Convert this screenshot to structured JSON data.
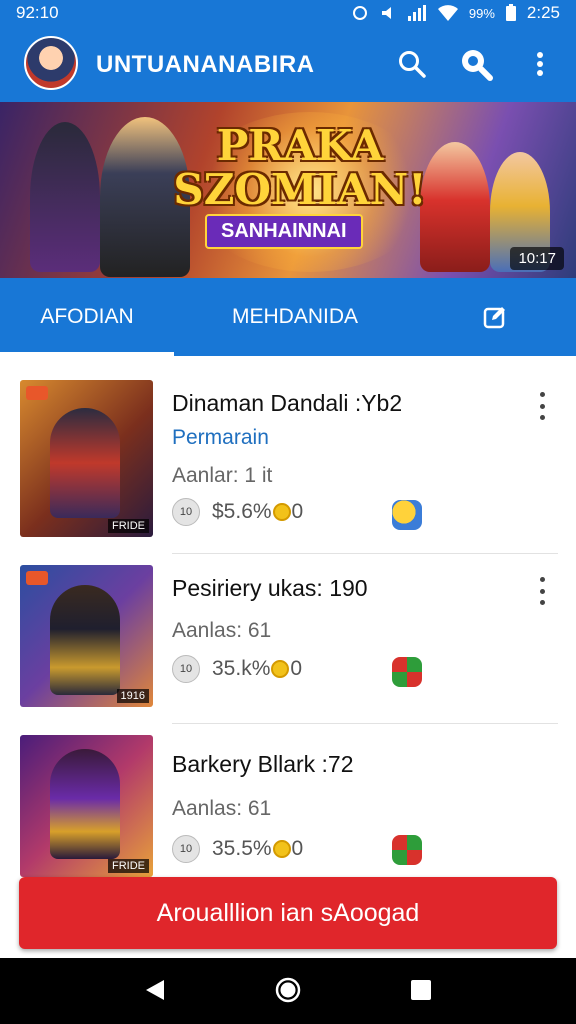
{
  "status_bar": {
    "time_left": "92:10",
    "battery": "99%",
    "time_right": "2:25"
  },
  "app_bar": {
    "title": "UNTUANANABIRA",
    "icons": [
      "avatar",
      "search-icon",
      "search-filled-icon",
      "more-vert-icon"
    ]
  },
  "banner": {
    "title": "PRAKA SZOMIAN!",
    "subtitle": "SANHAINNAI",
    "timestamp": "10:17"
  },
  "tabs": [
    {
      "label": "AFODIAN",
      "selected": true
    },
    {
      "label": "MEHDANIDA",
      "selected": false
    },
    {
      "label": "",
      "icon": "edit-icon"
    }
  ],
  "items": [
    {
      "title": "Dinaman Dandali :Yb2",
      "subtitle": "Permarain",
      "meta": "Aanlar: 1 it",
      "chip": "10",
      "price": "$5.6%",
      "coin_suffix": "0",
      "thumb_tag": "FRIDE",
      "icon": "emoji-icon"
    },
    {
      "title": "Pesiriery ukas: 190",
      "subtitle": "",
      "meta": "Aanlas: 61",
      "chip": "10",
      "price": "35.k%",
      "coin_suffix": "0",
      "thumb_tag": "1916",
      "icon": "green-red-icon"
    },
    {
      "title": "Barkery Bllark :72",
      "subtitle": "",
      "meta": "Aanlas: 61",
      "chip": "10",
      "price": "35.5%",
      "coin_suffix": "0",
      "thumb_tag": "FRIDE",
      "icon": "green-red-icon"
    }
  ],
  "cta": {
    "label": "Aroualllion ian sAoogad"
  },
  "colors": {
    "primary": "#1877d6",
    "cta": "#e0262b",
    "link": "#1f6fbf"
  }
}
